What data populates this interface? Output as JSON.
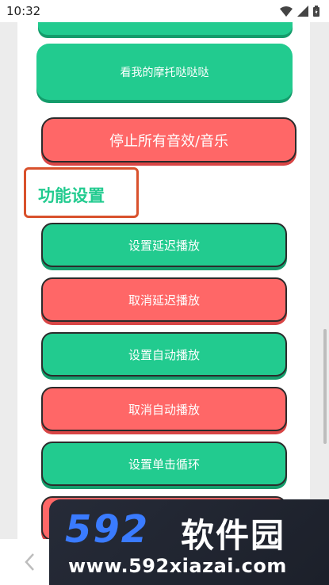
{
  "status_bar": {
    "time": "10:32",
    "icons": [
      "wifi-icon",
      "signal-icon",
      "battery-icon"
    ]
  },
  "buttons": {
    "moto_label": "看我的摩托哒哒哒",
    "stop_all_label": "停止所有音效/音乐"
  },
  "section": {
    "title": "功能设置"
  },
  "function_buttons": [
    {
      "label": "设置延迟播放",
      "color": "#22cb8f"
    },
    {
      "label": "取消延迟播放",
      "color": "#ff6767"
    },
    {
      "label": "设置自动播放",
      "color": "#22cb8f"
    },
    {
      "label": "取消自动播放",
      "color": "#ff6767"
    },
    {
      "label": "设置单击循环",
      "color": "#22cb8f"
    }
  ],
  "colors": {
    "accent_green": "#22cb8f",
    "accent_red": "#ff6767",
    "highlight_border": "#d9512c"
  },
  "watermark": {
    "number": "592",
    "name": "软件园",
    "url": "www.592xiazai.com"
  },
  "nav": {
    "back_icon": "chevron-left-icon"
  }
}
